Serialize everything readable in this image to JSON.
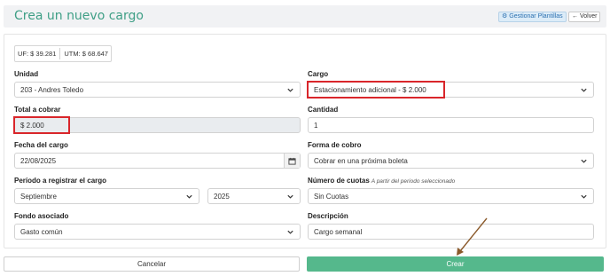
{
  "header": {
    "title": "Crea un nuevo cargo",
    "templates_label": "Gestionar Plantillas",
    "back_label": "Volver"
  },
  "indices": {
    "uf": "UF: $ 39.281",
    "utm": "UTM: $ 68.647"
  },
  "form": {
    "unidad": {
      "label": "Unidad",
      "value": "203 - Andres Toledo"
    },
    "cargo": {
      "label": "Cargo",
      "value": "Estacionamiento adicional - $ 2.000"
    },
    "total": {
      "label": "Total a cobrar",
      "value": "$ 2.000"
    },
    "cantidad": {
      "label": "Cantidad",
      "value": "1"
    },
    "fecha": {
      "label": "Fecha del cargo",
      "value": "22/08/2025"
    },
    "forma_cobro": {
      "label": "Forma de cobro",
      "value": "Cobrar en una próxima boleta"
    },
    "periodo": {
      "label": "Período a registrar el cargo",
      "month": "Septiembre",
      "year": "2025"
    },
    "cuotas": {
      "label": "Número de cuotas",
      "hint": "A partir del periodo seleccionado",
      "value": "Sin Cuotas"
    },
    "fondo": {
      "label": "Fondo asociado",
      "value": "Gasto común"
    },
    "descripcion": {
      "label": "Descripción",
      "value": "Cargo semanal"
    }
  },
  "actions": {
    "cancel_label": "Cancelar",
    "create_label": "Crear"
  },
  "colors": {
    "accent": "#3f9f86",
    "create_button": "#55b88c",
    "highlight": "#d9262b",
    "arrow": "#8b5a2b"
  },
  "icons": {
    "templates": "gear-icon",
    "back": "arrow-left-icon",
    "dropdown": "chevron-down-icon",
    "date": "calendar-icon"
  }
}
